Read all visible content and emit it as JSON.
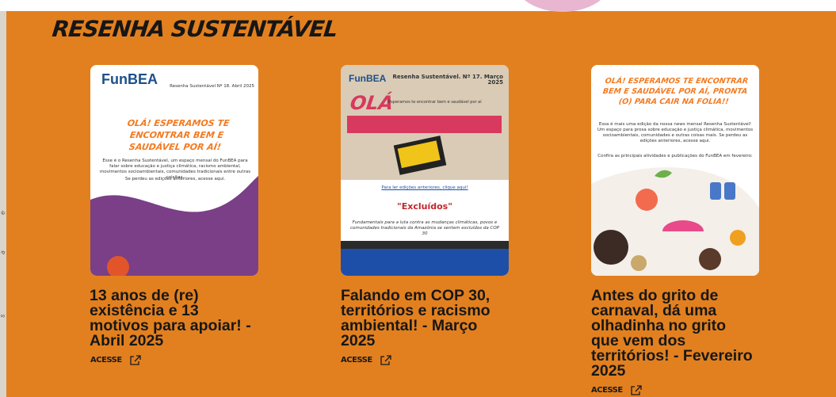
{
  "section": {
    "title": "RESENHA SUSTENTÁVEL"
  },
  "cards": [
    {
      "title": "13 anos de (re) existência e 13 motivos para apoiar! - Abril 2025",
      "link": "ACESSE",
      "thumb": {
        "logo": "FunBEA",
        "header": "Resenha Sustentável Nº 18. Abril 2025",
        "greeting": "OLÁ! ESPERAMOS TE ENCONTRAR BEM E SAUDÁVEL POR AÍ!",
        "body": "Esse é o Resenha Sustentável, um espaço mensal do FunBEA para falar sobre educação e justiça climática, racismo ambiental, movimentos socioambientais, comunidades tradicionais entre outras coisitas.",
        "more": "Se perdeu as edições anteriores, acesse aqui."
      }
    },
    {
      "title": "Falando em COP 30, territórios e racismo ambiental! - Março 2025",
      "link": "ACESSE",
      "thumb": {
        "logo": "FunBEA",
        "header": "Resenha Sustentável. Nº 17. Março 2025",
        "greeting": "OLÁ",
        "sub": "Esperamos te encontrar bem e saudável por aí",
        "link_text": "Para ler edições anteriores, clique aqui!",
        "heading": "\"Excluídos\"",
        "body": "Fundamentais para a luta contra as mudanças climáticas, povos e comunidades tradicionais da Amazônia se sentem excluídos da COP 30"
      }
    },
    {
      "title": "Antes do grito de carnaval, dá uma olhadinha no grito que vem dos territórios! - Fevereiro 2025",
      "link": "ACESSE",
      "thumb": {
        "greeting": "OLÁ! ESPERAMOS TE ENCONTRAR BEM E SAUDÁVEL POR AÍ, PRONTA (O) PARA CAIR NA FOLIA!!",
        "body": "Essa é mais uma edição da nossa news mensal Resenha Sustentável! Um espaço para prosa sobre educação e justiça climática, movimentos socioambientais, comunidades e outras coisas mais. Se perdeu as edições anteriores, acesse aqui.",
        "more": "Confira as principais atividades e publicações do FunBEA em fevereiro:"
      }
    }
  ],
  "colors": {
    "background": "#e2801f",
    "text": "#171717",
    "accent_orange": "#f47a20",
    "purple": "#7a3f86"
  }
}
